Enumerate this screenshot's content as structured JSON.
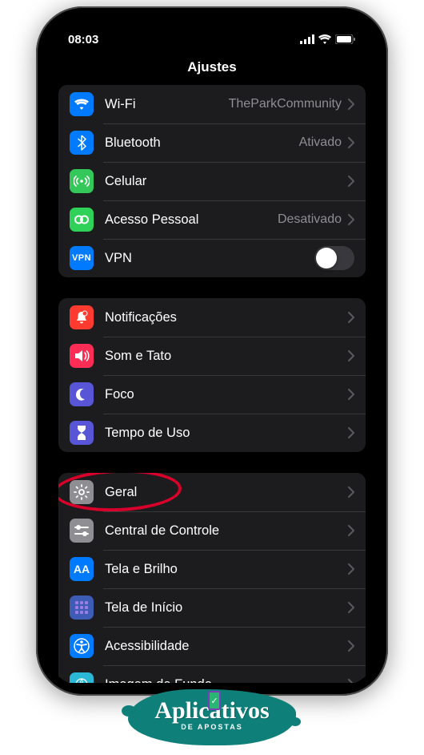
{
  "status": {
    "time": "08:03"
  },
  "header": {
    "title": "Ajustes"
  },
  "section1": {
    "wifi": {
      "label": "Wi-Fi",
      "value": "TheParkCommunity"
    },
    "bluetooth": {
      "label": "Bluetooth",
      "value": "Ativado"
    },
    "cellular": {
      "label": "Celular"
    },
    "hotspot": {
      "label": "Acesso Pessoal",
      "value": "Desativado"
    },
    "vpn": {
      "label": "VPN",
      "badge": "VPN"
    }
  },
  "section2": {
    "notifications": {
      "label": "Notificações"
    },
    "sound": {
      "label": "Som e Tato"
    },
    "focus": {
      "label": "Foco"
    },
    "screentime": {
      "label": "Tempo de Uso"
    }
  },
  "section3": {
    "general": {
      "label": "Geral"
    },
    "controlcenter": {
      "label": "Central de Controle"
    },
    "display": {
      "label": "Tela e Brilho",
      "badge": "AA"
    },
    "home": {
      "label": "Tela de Início"
    },
    "accessibility": {
      "label": "Acessibilidade"
    },
    "wallpaper": {
      "label": "Imagem de Fundo"
    }
  },
  "logo": {
    "main": "Aplicativos",
    "sub": "DE APOSTAS",
    "check": "✓"
  }
}
